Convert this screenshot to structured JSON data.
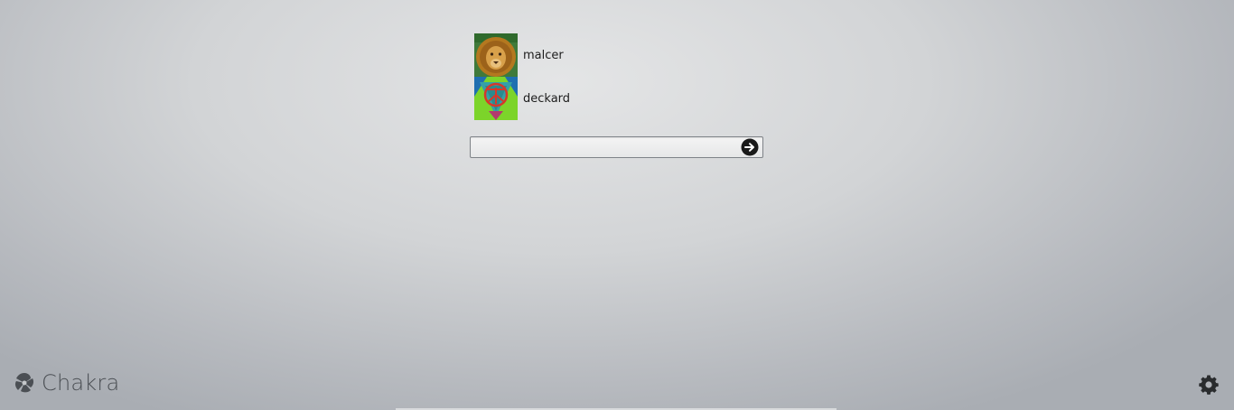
{
  "users": [
    {
      "name": "malcer",
      "avatar": "lion-avatar"
    },
    {
      "name": "deckard",
      "avatar": "green-emblem-avatar"
    }
  ],
  "login": {
    "password_value": "",
    "submit_icon": "arrow-right-circle-icon"
  },
  "brand": {
    "name": "Chakra",
    "logo_icon": "chakra-logo-icon"
  },
  "settings": {
    "icon": "gear-icon"
  },
  "colors": {
    "background": "#d2d4d6",
    "text": "#1d1d1d",
    "brand_text": "#4b4f54"
  }
}
